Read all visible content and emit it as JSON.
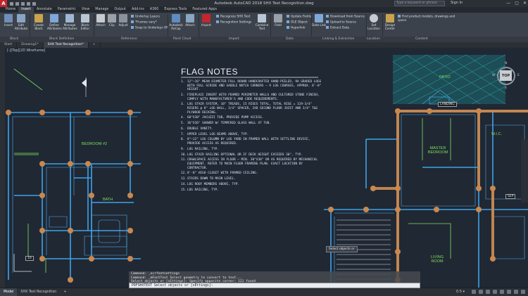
{
  "window": {
    "title": "Autodesk AutoCAD 2018   SHX Text Recognition.dwg",
    "search_placeholder": "Type a keyword or phrase",
    "signin": "Sign In",
    "controls": [
      "—",
      "▢",
      "✕"
    ]
  },
  "app_logo": "A",
  "ribbon_tabs": [
    "Home",
    "Insert",
    "Annotate",
    "Parametric",
    "View",
    "Manage",
    "Output",
    "Add-ins",
    "A360",
    "Express Tools",
    "Featured Apps"
  ],
  "ribbon_active_tab": 1,
  "ribbon": {
    "block_buttons": [
      "Insert",
      "Edit Attribute",
      "Create Block",
      "Define Attributes",
      "Manage Attributes",
      "Block Editor"
    ],
    "reference_buttons": [
      "Attach",
      "Clip",
      "Adjust"
    ],
    "reference_small": [
      "Underlay Layers",
      "*Frames vary*",
      "Snap to Underlays ON"
    ],
    "pointcloud_buttons": [
      "Autodesk ReCap",
      "Attach"
    ],
    "import_button": "Import",
    "import_small": [
      "Recognize SHX Text",
      "Recognition Settings"
    ],
    "combine_buttons": [
      "Combine Text",
      "Field"
    ],
    "data_small": [
      "Update Fields",
      "OLE Object",
      "Hyperlink"
    ],
    "linking_small": [
      "Download from Source",
      "Upload to Source",
      "Extract Data"
    ],
    "linking_buttons": [
      "Data Link"
    ],
    "location_button": "Set Location",
    "content_button": "Design Center",
    "content_small": "Find product models, drawings and specs",
    "panel_labels": [
      "Block",
      "Block Definition",
      "Reference",
      "Point Cloud",
      "Import",
      "Data",
      "Linking & Extraction",
      "Location",
      "Content"
    ]
  },
  "file_tabs": [
    "Start",
    "Drawing1*",
    "SHX Text Recognition*"
  ],
  "file_active_tab": 2,
  "view_label": "[-][Top][2D Wireframe]",
  "flag_notes": {
    "title": "FLAG NOTES",
    "items": [
      {
        "n": "1.",
        "text": "12\"–16\" MEAN DIAMETER FULL ROUND HANDCRAFTED HAND-PEELED, 9A GRADED LOGS WITH FULL SCRIBE AND SADDLE NOTCH CORNERS – 9 LOG COURSES, APPROX. 8'-0\" HEIGHT."
      },
      {
        "n": "2.",
        "text": "FIREPLACE INSERT WITH FRAMED PERIMETER WALLS AND CULTURED STONE FINISH, COMPLY WITH MANUFACTURER'S AND CODE REQUIREMENTS."
      },
      {
        "n": "3.",
        "text": "LOG STAIR SYSTEM, 10\" TREADS, 15 RISES TOTAL, TOTAL RISE = 119-3/4\" RISERS @ 8\" LOG WALL, 3/4\" SPACER, 2X8 SECOND FLOOR JOIST AND 3/4\" T&G PLYWOOD DECKING."
      },
      {
        "n": "4.",
        "text": "60\"X30\" JACUZZI TUB, PROVIDE PUMP ACCESS."
      },
      {
        "n": "5.",
        "text": "36\"X36\" SHOWER w/ TEMPERED GLASS WALL AT TUB."
      },
      {
        "n": "6.",
        "text": "DOUBLE VANITY."
      },
      {
        "n": "7.",
        "text": "UPPER LEVEL LOG BEAMS ABOVE, TYP."
      },
      {
        "n": "8.",
        "text": "8\"–12\" LOG COLUMN BY LOG YARD IN FRAMED WALL WITH SETTLING DEVICE, PROVIDE ACCESS AS REQUIRED."
      },
      {
        "n": "9.",
        "text": "LOG RAILING, TYP."
      },
      {
        "n": "10.",
        "text": "LOG STAIR RAILING OPTIONAL OR IF DECK HEIGHT EXCEEDS 30\", TYP."
      },
      {
        "n": "11.",
        "text": "CRAWLSPACE ACCESS IN FLOOR – MIN. 30\"x30\" OR AS REQUIRED BY MECHANICAL EQUIPMENT. REFER TO MAIN FLOOR FRAMING PLAN. EXACT LOCATION BY CONTRACTOR."
      },
      {
        "n": "12.",
        "text": "8'-0\" HIGH CLOSET WITH FRAMED CEILING."
      },
      {
        "n": "13.",
        "text": "STAIRS DOWN TO MAIN LEVEL."
      },
      {
        "n": "14.",
        "text": "LOG ROOF MEMBERS ABOVE, TYP."
      },
      {
        "n": "15.",
        "text": "LOG RAILING, TYP."
      }
    ]
  },
  "rooms": {
    "bedroom2": "BEDROOM #2",
    "bath": "BATH",
    "patio": "PATIO",
    "master": "MASTER BEDROOM",
    "wic": "W.I.C.",
    "living": "LIVING ROOM",
    "landing": "LANDING",
    "sep": "SEP",
    "sep_value": "10"
  },
  "viewcube": {
    "top": "TOP",
    "n": "N",
    "s": "S",
    "e": "E",
    "w": "W"
  },
  "select_prompt": "Select objects or",
  "command_history": [
    "Command: _ocrfontsettings",
    "Command: _mFontText Select geometry to convert to text...",
    "Select objects or [sEttings]: Specify opposite corner: 121 found"
  ],
  "command_prompt": "PDFSHXTEXT Select objects or [sEttings]:",
  "status_tabs": [
    "Model",
    "SHX Text Recognition"
  ],
  "status_active_tab": 0,
  "status_scale": "0.5 ▾",
  "colors": {
    "room_text": "#7de05a",
    "log_node": "#c9884f",
    "wall": "#3ea3e8",
    "hatch": "#2fb5b5"
  }
}
